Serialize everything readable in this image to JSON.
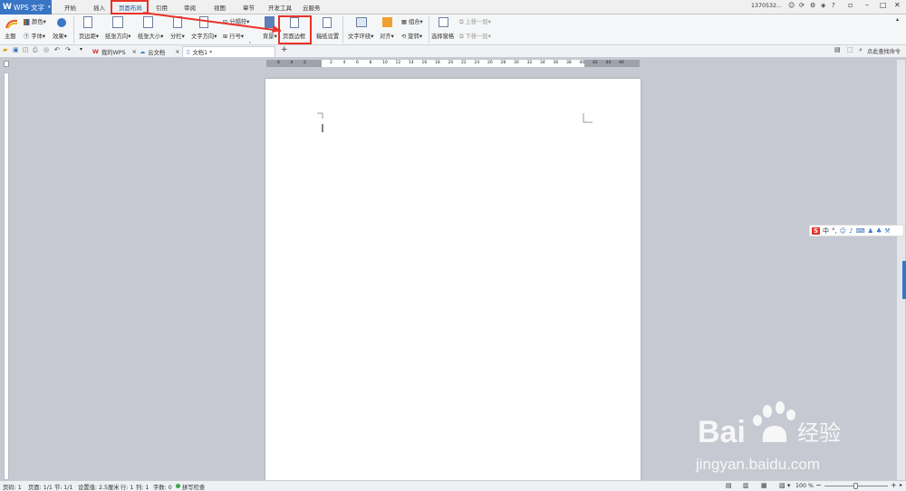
{
  "app": {
    "title": "WPS 文字"
  },
  "menu": {
    "items": [
      "开始",
      "插入",
      "页面布局",
      "引用",
      "审阅",
      "视图",
      "章节",
      "开发工具",
      "云服务"
    ],
    "active": "页面布局"
  },
  "account": {
    "user": "1370532..."
  },
  "ribbon": {
    "theme_label": "主题",
    "color_label": "颜色",
    "font_label": "字体",
    "effect_label": "效果",
    "margins_label": "页边距",
    "orientation_label": "纸张方向",
    "size_label": "纸张大小",
    "columns_label": "分栏",
    "text_direction_label": "文字方向",
    "line_numbers_label": "行号",
    "breaks_label": "分隔符",
    "background_label": "背景",
    "page_border_label": "页面边框",
    "manuscript_label": "稿纸设置",
    "wrap_text_label": "文字环绕",
    "align_label": "对齐",
    "group_label": "组合",
    "rotate_label": "旋转",
    "selection_pane_label": "选择窗格",
    "bring_forward_label": "上移一层",
    "send_backward_label": "下移一层"
  },
  "tabs": {
    "items": [
      {
        "label": "我的WPS"
      },
      {
        "label": "云文档"
      },
      {
        "label": "文档1 *"
      }
    ],
    "add_label": "+",
    "search_label": "点此查找命令"
  },
  "ruler": {
    "ticks": [
      "6",
      "4",
      "2",
      "",
      "2",
      "4",
      "6",
      "8",
      "10",
      "12",
      "14",
      "16",
      "18",
      "20",
      "22",
      "24",
      "26",
      "28",
      "30",
      "32",
      "34",
      "36",
      "38",
      "40",
      "42",
      "44",
      "46"
    ]
  },
  "status": {
    "page_num": "页码: 1",
    "pages": "页面: 1/1",
    "section": "节: 1/1",
    "position": "设置值: 2.5厘米",
    "line": "行: 1",
    "column": "列: 1",
    "words": "字数: 0",
    "spell": "拼写检查",
    "zoom": "100 %"
  },
  "ime": {
    "label": "中"
  },
  "watermark": {
    "brand": "Bai",
    "brand2": "经验",
    "url": "jingyan.baidu.com"
  },
  "colors": {
    "accent": "#3875c4",
    "highlight": "#e8322a"
  }
}
